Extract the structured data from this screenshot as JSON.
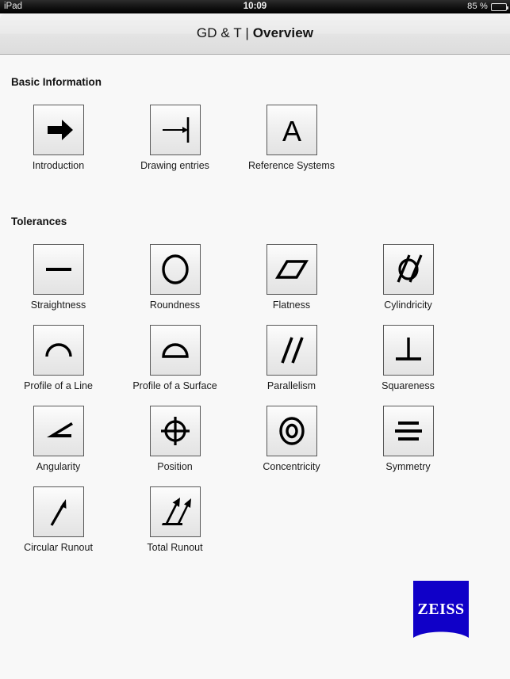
{
  "statusbar": {
    "device": "iPad",
    "clock": "10:09",
    "battery_percent": "85 %",
    "battery_icon": "battery-icon"
  },
  "navbar": {
    "title_prefix": "GD & T | ",
    "title_bold": "Overview"
  },
  "sections": [
    {
      "id": "basic",
      "title": "Basic Information",
      "items": [
        {
          "label": "Introduction",
          "icon": "arrow-right-icon"
        },
        {
          "label": "Drawing entries",
          "icon": "arrow-to-line-icon"
        },
        {
          "label": "Reference Systems",
          "icon": "letter-a-icon"
        }
      ]
    },
    {
      "id": "tolerances",
      "title": "Tolerances",
      "items": [
        {
          "label": "Straightness",
          "icon": "straightness-icon"
        },
        {
          "label": "Roundness",
          "icon": "roundness-icon"
        },
        {
          "label": "Flatness",
          "icon": "flatness-icon"
        },
        {
          "label": "Cylindricity",
          "icon": "cylindricity-icon"
        },
        {
          "label": "Profile of a Line",
          "icon": "profile-line-icon"
        },
        {
          "label": "Profile of a Surface",
          "icon": "profile-surface-icon"
        },
        {
          "label": "Parallelism",
          "icon": "parallelism-icon"
        },
        {
          "label": "Squareness",
          "icon": "squareness-icon"
        },
        {
          "label": "Angularity",
          "icon": "angularity-icon"
        },
        {
          "label": "Position",
          "icon": "position-icon"
        },
        {
          "label": "Concentricity",
          "icon": "concentricity-icon"
        },
        {
          "label": "Symmetry",
          "icon": "symmetry-icon"
        },
        {
          "label": "Circular Runout",
          "icon": "circular-runout-icon"
        },
        {
          "label": "Total Runout",
          "icon": "total-runout-icon"
        }
      ]
    }
  ],
  "logo": {
    "text": "ZEISS",
    "color": "#1000c8"
  },
  "colors": {
    "page_background": "#f8f8f8",
    "navbar_background": "#e8e8e8",
    "statusbar_background": "#000000",
    "tile_border": "#585858",
    "symbol": "#000000"
  }
}
